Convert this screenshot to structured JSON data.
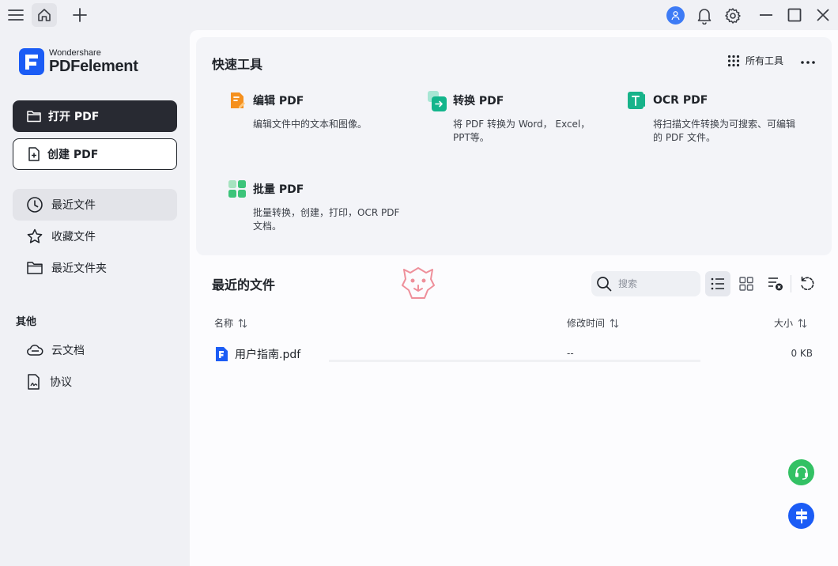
{
  "app": {
    "brand_sub": "Wondershare",
    "brand_main": "PDFelement",
    "brand_color": "#1b5cf5"
  },
  "titlebar": {
    "icons": [
      "menu-icon",
      "home-icon",
      "plus-icon",
      "user-avatar",
      "bell-icon",
      "gear-icon",
      "minimize-icon",
      "maximize-icon",
      "close-icon"
    ]
  },
  "sidebar": {
    "open_pdf": "打开 PDF",
    "create_pdf": "创建 PDF",
    "items": [
      {
        "label": "最近文件",
        "icon": "clock-icon",
        "active": true
      },
      {
        "label": "收藏文件",
        "icon": "star-icon",
        "active": false
      },
      {
        "label": "最近文件夹",
        "icon": "folder-icon",
        "active": false
      }
    ],
    "section_other": "其他",
    "other_items": [
      {
        "label": "云文档",
        "icon": "cloud-icon"
      },
      {
        "label": "协议",
        "icon": "agreement-icon"
      }
    ]
  },
  "quick_tools": {
    "title": "快速工具",
    "all_tools": "所有工具",
    "tools": [
      {
        "name": "编辑 PDF",
        "desc": "编辑文件中的文本和图像。",
        "icon": "edit-pdf-icon",
        "color": "#f5901e"
      },
      {
        "name": "转换 PDF",
        "desc": "将 PDF 转换为 Word， Excel，PPT等。",
        "icon": "convert-pdf-icon",
        "color": "#13b58c"
      },
      {
        "name": "OCR PDF",
        "desc": "将扫描文件转换为可搜索、可编辑的 PDF 文件。",
        "icon": "ocr-pdf-icon",
        "color": "#17b38a"
      },
      {
        "name": "批量 PDF",
        "desc": "批量转换，创建，打印，OCR PDF 文档。",
        "icon": "batch-pdf-icon",
        "color": "#3cc47a"
      }
    ]
  },
  "recent": {
    "title": "最近的文件",
    "search_placeholder": "搜索",
    "columns": {
      "name": "名称",
      "modified": "修改时间",
      "size": "大小"
    },
    "files": [
      {
        "name": "用户指南.pdf",
        "modified": "--",
        "size": "0 KB"
      }
    ]
  },
  "fabs": {
    "support_color": "#33c164",
    "switch_color": "#1b5cf5"
  }
}
